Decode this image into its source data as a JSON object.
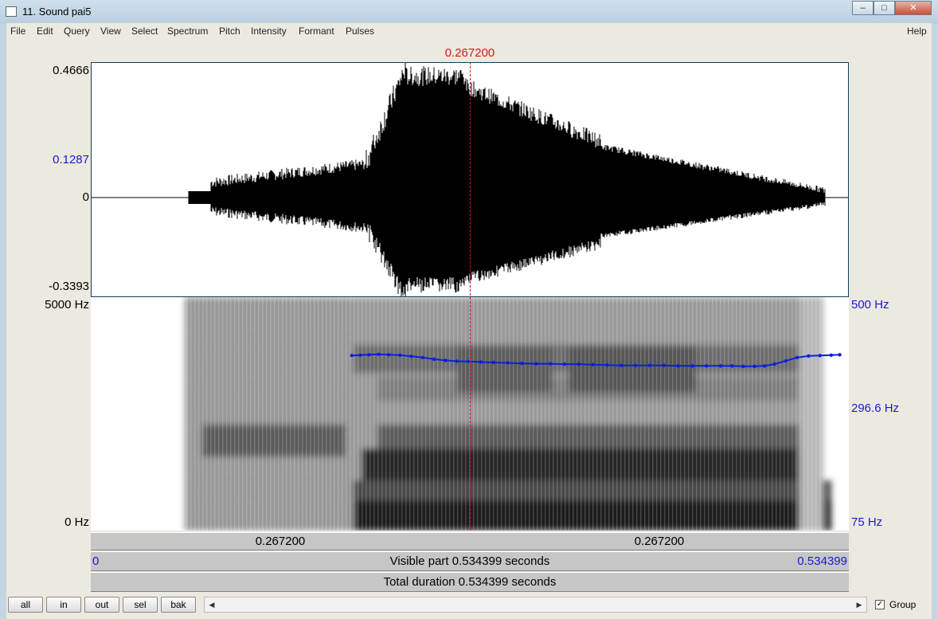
{
  "window": {
    "title": "11. Sound pai5",
    "controls": {
      "minimize": "–",
      "maximize": "□",
      "close": "✕"
    }
  },
  "menu": {
    "left": [
      "File",
      "Edit",
      "Query",
      "View",
      "Select",
      "Spectrum",
      "Pitch",
      "Intensity",
      "Formant",
      "Pulses"
    ],
    "right": "Help"
  },
  "cursor": {
    "time_label": "0.267200"
  },
  "waveform": {
    "y_top": "0.4666",
    "y_mark": "0.1287",
    "y_zero": "0",
    "y_bottom": "-0.3393"
  },
  "spectrogram": {
    "freq_top": "5000 Hz",
    "freq_bottom": "0 Hz",
    "pitch_top": "500 Hz",
    "pitch_value": "296.6 Hz",
    "pitch_bottom": "75 Hz",
    "pitch_min_hz": 75,
    "pitch_max_hz": 500,
    "pitch_line_color": "#0b1fe0",
    "pitch_points": [
      [
        0.184,
        311
      ],
      [
        0.19,
        312
      ],
      [
        0.196,
        313
      ],
      [
        0.203,
        314
      ],
      [
        0.21,
        313
      ],
      [
        0.218,
        312
      ],
      [
        0.226,
        309
      ],
      [
        0.234,
        306
      ],
      [
        0.242,
        302
      ],
      [
        0.25,
        299
      ],
      [
        0.258,
        297
      ],
      [
        0.266,
        296.6
      ],
      [
        0.275,
        295
      ],
      [
        0.284,
        294
      ],
      [
        0.294,
        293
      ],
      [
        0.304,
        292
      ],
      [
        0.314,
        291
      ],
      [
        0.324,
        291
      ],
      [
        0.334,
        290
      ],
      [
        0.344,
        290
      ],
      [
        0.354,
        289
      ],
      [
        0.364,
        288
      ],
      [
        0.374,
        287
      ],
      [
        0.384,
        287
      ],
      [
        0.394,
        287
      ],
      [
        0.404,
        287
      ],
      [
        0.414,
        286
      ],
      [
        0.424,
        286
      ],
      [
        0.434,
        286
      ],
      [
        0.444,
        286
      ],
      [
        0.452,
        286
      ],
      [
        0.46,
        285
      ],
      [
        0.468,
        285
      ],
      [
        0.475,
        286
      ],
      [
        0.482,
        290
      ],
      [
        0.49,
        298
      ],
      [
        0.498,
        306
      ],
      [
        0.506,
        310
      ],
      [
        0.514,
        311
      ],
      [
        0.522,
        312
      ],
      [
        0.528,
        313
      ]
    ]
  },
  "bars": {
    "left_half": "0.267200",
    "right_half": "0.267200",
    "visible_start": "0",
    "visible_text": "Visible part 0.534399 seconds",
    "visible_end": "0.534399",
    "total_text": "Total duration 0.534399 seconds"
  },
  "bottom": {
    "buttons": [
      "all",
      "in",
      "out",
      "sel",
      "bak"
    ],
    "group_checked": "✓",
    "group_label": "Group",
    "scroll_left": "◀",
    "scroll_right": "▶"
  },
  "colors": {
    "cursor": "#d01a1a",
    "axis_blue": "#1a1acc",
    "pitch": "#0b1fe0"
  }
}
